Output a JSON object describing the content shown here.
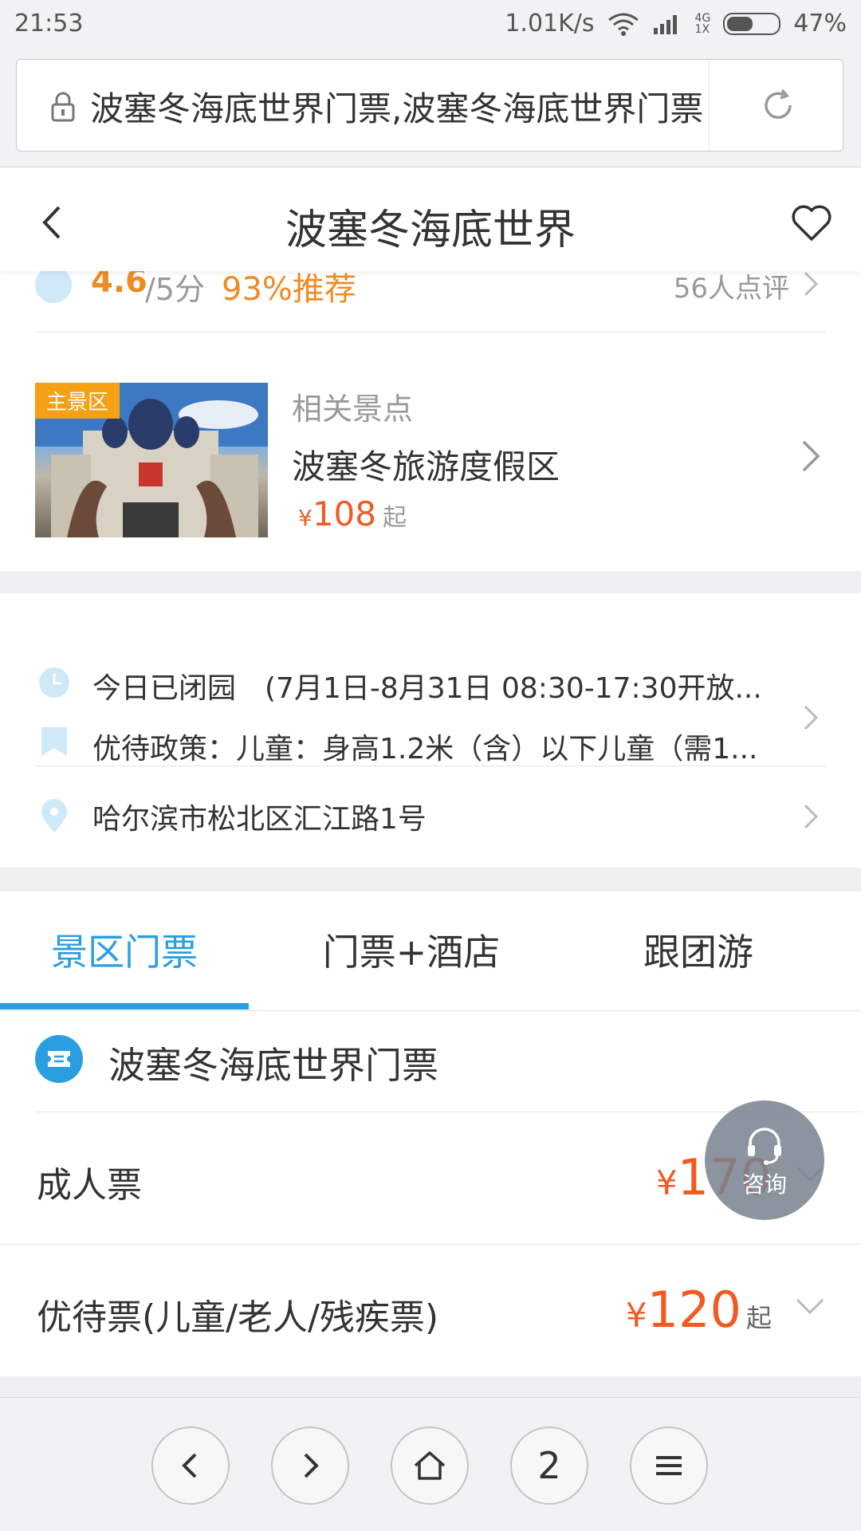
{
  "status_bar": {
    "time": "21:53",
    "speed": "1.01K/s",
    "network_top": "4G",
    "network_bottom": "1X",
    "battery": "47%",
    "battery_level": 0.47
  },
  "url_bar": {
    "url_text": "波塞冬海底世界门票,波塞冬海底世界门票"
  },
  "header": {
    "title": "波塞冬海底世界"
  },
  "rating": {
    "score": "4.6",
    "out_of": "/5分",
    "recommend": "93%推荐",
    "review_count": "56人点评"
  },
  "related_spot": {
    "tag": "主景区",
    "label": "相关景点",
    "name": "波塞冬旅游度假区",
    "currency": "¥",
    "price": "108",
    "price_suffix": "起"
  },
  "info": {
    "hours": "今日已闭园　(7月1日-8月31日 08:30-17:30开放...",
    "policy": "优待政策：儿童：身高1.2米（含）以下儿童（需1...",
    "address": "哈尔滨市松北区汇江路1号"
  },
  "tabs": [
    {
      "label": "景区门票",
      "active": true
    },
    {
      "label": "门票+酒店",
      "active": false
    },
    {
      "label": "跟团游",
      "active": false
    }
  ],
  "tickets": {
    "title": "波塞冬海底世界门票",
    "rows": [
      {
        "name": "成人票",
        "currency": "¥",
        "price": "170",
        "suffix": ""
      },
      {
        "name": "优待票(儿童/老人/残疾票)",
        "currency": "¥",
        "price": "120",
        "suffix": "起"
      }
    ]
  },
  "consult": {
    "label": "咨询"
  },
  "bottom_nav": {
    "tab_count": "2"
  },
  "colors": {
    "accent_blue": "#2a9ee0",
    "price_orange": "#f15a22",
    "rating_orange": "#f08a24",
    "tag_orange": "#f5a015"
  },
  "icons": [
    "lock-icon",
    "reload-icon",
    "back-icon",
    "heart-icon",
    "smile-icon",
    "clock-icon",
    "bookmark-icon",
    "location-icon",
    "ticket-icon",
    "headset-icon",
    "chevron-right-icon",
    "chevron-down-icon",
    "home-icon",
    "menu-icon"
  ]
}
